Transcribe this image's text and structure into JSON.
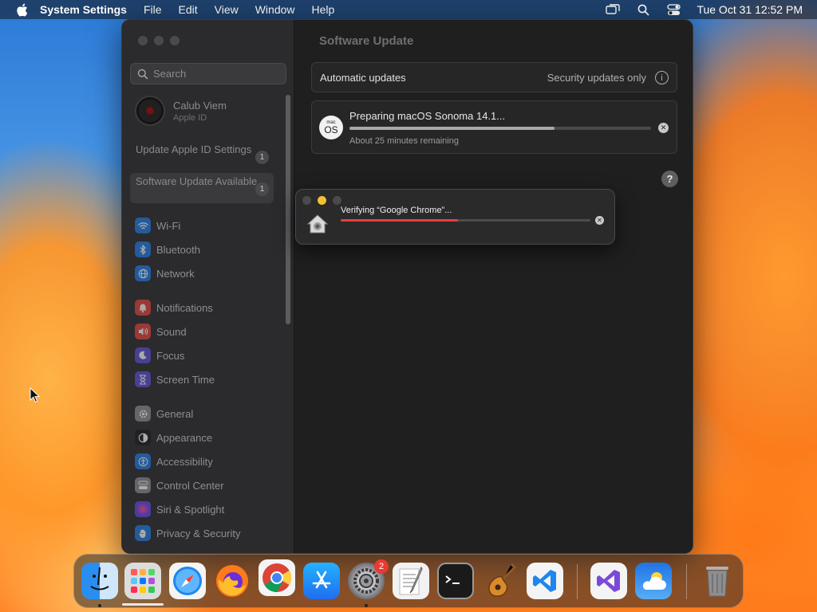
{
  "menubar": {
    "app_name": "System Settings",
    "menus": [
      "File",
      "Edit",
      "View",
      "Window",
      "Help"
    ],
    "clock": "Tue Oct 31  12:52 PM"
  },
  "window": {
    "sidebar": {
      "search_placeholder": "Search",
      "profile": {
        "name": "Calub Viem",
        "subtitle": "Apple ID"
      },
      "notices": [
        {
          "label": "Update Apple ID Settings",
          "badge": "1"
        },
        {
          "label": "Software Update Available",
          "badge": "1"
        }
      ],
      "items": [
        {
          "label": "Wi-Fi",
          "icon": "wifi-icon",
          "color": "#1e7ce6"
        },
        {
          "label": "Bluetooth",
          "icon": "bluetooth-icon",
          "color": "#1e7ce6"
        },
        {
          "label": "Network",
          "icon": "globe-icon",
          "color": "#1e7ce6"
        },
        {
          "label": "Notifications",
          "icon": "bell-icon",
          "color": "#e6453b"
        },
        {
          "label": "Sound",
          "icon": "speaker-icon",
          "color": "#e6453b"
        },
        {
          "label": "Focus",
          "icon": "moon-icon",
          "color": "#5b4fd8"
        },
        {
          "label": "Screen Time",
          "icon": "hourglass-icon",
          "color": "#5b4fd8"
        },
        {
          "label": "General",
          "icon": "gear-icon",
          "color": "#8e8e93"
        },
        {
          "label": "Appearance",
          "icon": "appearance-icon",
          "color": "#1c1c1e"
        },
        {
          "label": "Accessibility",
          "icon": "accessibility-icon",
          "color": "#1e7ce6"
        },
        {
          "label": "Control Center",
          "icon": "control-center-icon",
          "color": "#8e8e93"
        },
        {
          "label": "Siri & Spotlight",
          "icon": "siri-icon",
          "color": "#b13fd6"
        },
        {
          "label": "Privacy & Security",
          "icon": "hand-icon",
          "color": "#1e7ce6"
        }
      ]
    },
    "content": {
      "title": "Software Update",
      "automatic_updates": {
        "label": "Automatic updates",
        "value": "Security updates only"
      },
      "update": {
        "badge_small": "mac",
        "badge_big": "OS",
        "title": "Preparing macOS Sonoma 14.1...",
        "remaining": "About 25 minutes remaining",
        "progress": 0.68
      },
      "help": "?"
    }
  },
  "popup": {
    "text": "Verifying “Google Chrome”...",
    "progress": 0.47,
    "color": "#e3403a"
  },
  "dock": {
    "apps": [
      {
        "name": "finder-icon",
        "color": "#2a8ef0"
      },
      {
        "name": "launchpad-icon",
        "color": "#dcdcdc"
      },
      {
        "name": "safari-icon",
        "color": "#f4f4f4"
      },
      {
        "name": "firefox-icon",
        "color": "#ff7a1a"
      },
      {
        "name": "chrome-icon",
        "color": "#f4f4f4"
      },
      {
        "name": "app-store-icon",
        "color": "#1f86f0"
      },
      {
        "name": "system-settings-icon",
        "color": "#8a8a8e"
      },
      {
        "name": "textedit-icon",
        "color": "#f2f2f2"
      },
      {
        "name": "terminal-icon",
        "color": "#1a1a1a"
      },
      {
        "name": "garageband-icon",
        "color": "#3a2a1a"
      },
      {
        "name": "vscode-icon",
        "color": "#f4f4f4"
      },
      {
        "name": "visual-studio-icon",
        "color": "#f4f4f4"
      },
      {
        "name": "weather-icon",
        "color": "#2b8ef0"
      },
      {
        "name": "trash-icon",
        "color": "#8e8e90"
      }
    ],
    "settings_badge": "2"
  }
}
